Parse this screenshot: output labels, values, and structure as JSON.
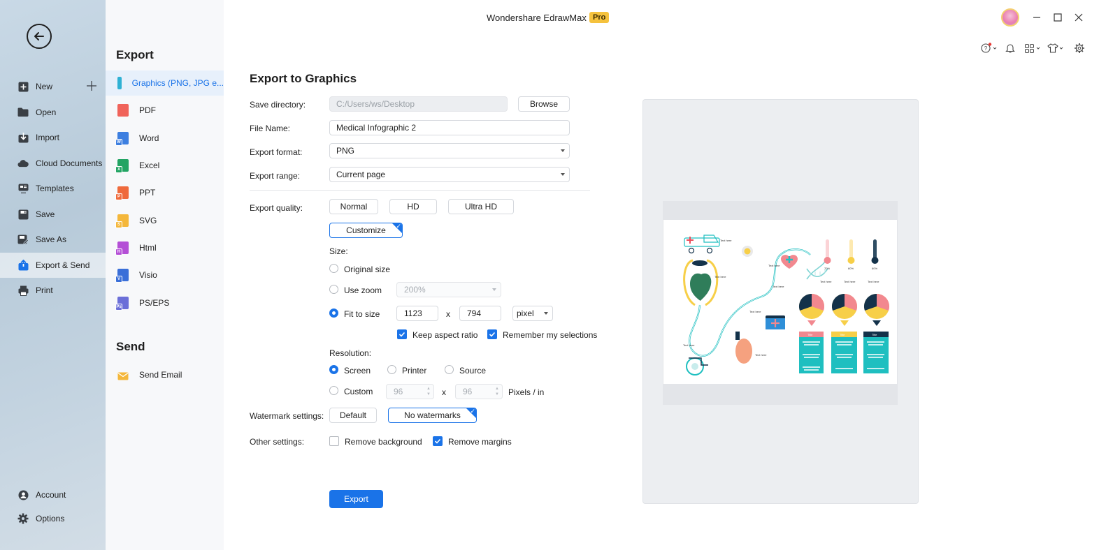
{
  "app": {
    "title": "Wondershare EdrawMax",
    "badge": "Pro"
  },
  "nav": {
    "items": [
      {
        "label": "New",
        "icon": "new-icon"
      },
      {
        "label": "Open",
        "icon": "folder-icon"
      },
      {
        "label": "Import",
        "icon": "import-icon"
      },
      {
        "label": "Cloud Documents",
        "icon": "cloud-icon"
      },
      {
        "label": "Templates",
        "icon": "templates-icon"
      },
      {
        "label": "Save",
        "icon": "save-icon"
      },
      {
        "label": "Save As",
        "icon": "save-as-icon"
      },
      {
        "label": "Export & Send",
        "icon": "export-icon",
        "active": true
      },
      {
        "label": "Print",
        "icon": "print-icon"
      }
    ],
    "bottom": [
      {
        "label": "Account",
        "icon": "account-icon"
      },
      {
        "label": "Options",
        "icon": "gear-icon"
      }
    ]
  },
  "submenu": {
    "export_heading": "Export",
    "export_items": [
      {
        "label": "Graphics (PNG, JPG e...",
        "color": "#2fb1d4",
        "tag": "",
        "active": true
      },
      {
        "label": "PDF",
        "color": "#f0635a",
        "tag": ""
      },
      {
        "label": "Word",
        "color": "#3d7fe0",
        "tag": "W"
      },
      {
        "label": "Excel",
        "color": "#22a463",
        "tag": "X"
      },
      {
        "label": "PPT",
        "color": "#ef6a3c",
        "tag": "P"
      },
      {
        "label": "SVG",
        "color": "#f4b73b",
        "tag": "S"
      },
      {
        "label": "Html",
        "color": "#b44fd6",
        "tag": "H"
      },
      {
        "label": "Visio",
        "color": "#3a6fd8",
        "tag": "V"
      },
      {
        "label": "PS/EPS",
        "color": "#6b6fd8",
        "tag": "Ps"
      }
    ],
    "send_heading": "Send",
    "send_items": [
      {
        "label": "Send Email",
        "color": "#f4b73b"
      }
    ]
  },
  "form": {
    "title": "Export to Graphics",
    "save_directory_label": "Save directory:",
    "save_directory_value": "C:/Users/ws/Desktop",
    "browse_label": "Browse",
    "file_name_label": "File Name:",
    "file_name_value": "Medical Infographic 2",
    "export_format_label": "Export format:",
    "export_format_value": "PNG",
    "export_range_label": "Export range:",
    "export_range_value": "Current page",
    "export_quality_label": "Export quality:",
    "quality_options": [
      "Normal",
      "HD",
      "Ultra HD"
    ],
    "customize_label": "Customize",
    "size_label": "Size:",
    "original_size_label": "Original size",
    "use_zoom_label": "Use zoom",
    "zoom_value": "200%",
    "fit_to_size_label": "Fit to size",
    "width_value": "1123",
    "height_value": "794",
    "x_sep": "x",
    "unit_value": "pixel",
    "keep_aspect_label": "Keep aspect ratio",
    "remember_label": "Remember my selections",
    "resolution_label": "Resolution:",
    "screen_label": "Screen",
    "printer_label": "Printer",
    "source_label": "Source",
    "custom_label": "Custom",
    "res_x_value": "96",
    "res_y_value": "96",
    "pixels_per_in": "Pixels / in",
    "watermark_label": "Watermark settings:",
    "watermark_default": "Default",
    "watermark_none": "No watermarks",
    "other_label": "Other settings:",
    "remove_background_label": "Remove background",
    "remove_margins_label": "Remove margins",
    "export_button": "Export"
  },
  "preview": {
    "labels": {
      "text_here": "Text here",
      "title": "Title",
      "replace": "Replace your text here",
      "p1": "70%",
      "p2": "60%",
      "p3": "60%"
    }
  },
  "colors": {
    "accent": "#1a73e8",
    "teal": "#1fbfc0",
    "pink": "#f2888f",
    "yellow": "#f7cf48",
    "navy": "#14324a"
  }
}
